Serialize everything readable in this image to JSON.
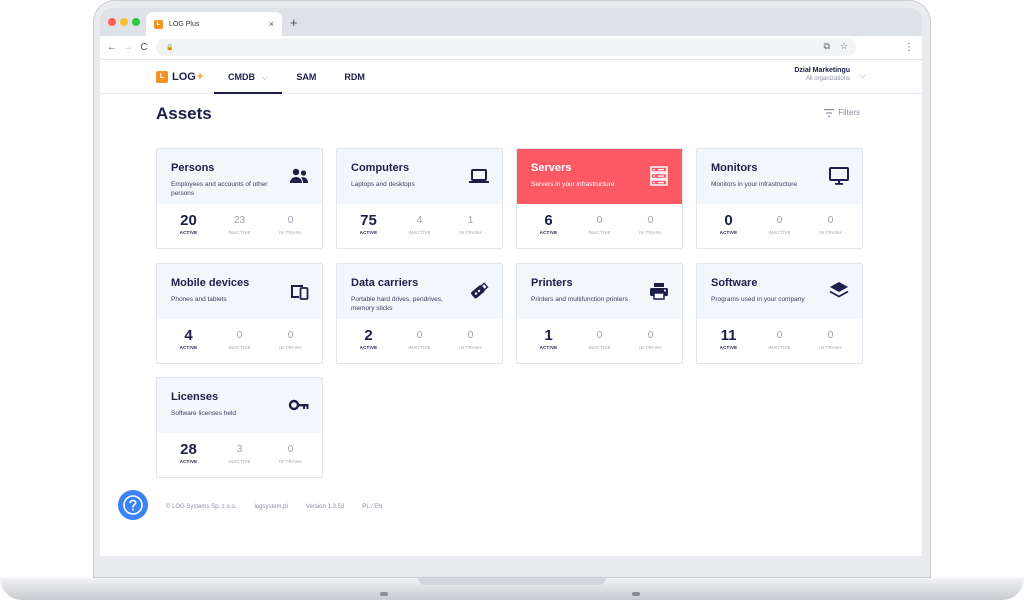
{
  "browser": {
    "tab_title": "LOG Plus",
    "tab_favicon_text": "L",
    "tab_close": "×",
    "new_tab": "+",
    "nav": {
      "back": "←",
      "forward": "→",
      "reload": "C"
    },
    "lock": "🔒",
    "translate_icon": "⧉",
    "star_icon": "☆",
    "menu": "⋮"
  },
  "header": {
    "logo_text": "LOG",
    "logo_plus": "+",
    "logo_box": "L",
    "nav": [
      {
        "label": "CMDB",
        "active": true,
        "chevron": "⌵"
      },
      {
        "label": "SAM"
      },
      {
        "label": "RDM"
      }
    ],
    "org_name": "Dział Marketingu",
    "org_sub": "All organizations",
    "org_chevron": "⌵"
  },
  "page": {
    "title": "Assets",
    "filters_label": "Filters"
  },
  "stat_labels": {
    "active": "ACTIVE",
    "inactive": "INACTIVE",
    "trash": "IN TRASH"
  },
  "cards": [
    {
      "title": "Persons",
      "desc": "Employees and accounts of other persons",
      "icon": "persons-icon",
      "active": "20",
      "inactive": "23",
      "trash": "0"
    },
    {
      "title": "Computers",
      "desc": "Laptops and desktops",
      "icon": "laptop-icon",
      "active": "75",
      "inactive": "4",
      "trash": "1"
    },
    {
      "title": "Servers",
      "desc": "Servers in your infrastructure",
      "icon": "server-icon",
      "active": "6",
      "inactive": "0",
      "trash": "0",
      "featured": true
    },
    {
      "title": "Monitors",
      "desc": "Monitors in your infrastructure",
      "icon": "monitor-icon",
      "active": "0",
      "inactive": "0",
      "trash": "0"
    },
    {
      "title": "Mobile devices",
      "desc": "Phones and tablets",
      "icon": "mobile-devices-icon",
      "active": "4",
      "inactive": "0",
      "trash": "0"
    },
    {
      "title": "Data carriers",
      "desc": "Portable hard drives, pendrives, memory sticks",
      "icon": "usb-drive-icon",
      "active": "2",
      "inactive": "0",
      "trash": "0"
    },
    {
      "title": "Printers",
      "desc": "Printers and multifunction printers",
      "icon": "printer-icon",
      "active": "1",
      "inactive": "0",
      "trash": "0"
    },
    {
      "title": "Software",
      "desc": "Programs used in your company",
      "icon": "layers-icon",
      "active": "11",
      "inactive": "0",
      "trash": "0"
    },
    {
      "title": "Licenses",
      "desc": "Software licenses held",
      "icon": "key-icon",
      "active": "28",
      "inactive": "3",
      "trash": "0"
    }
  ],
  "footer": {
    "copyright": "© LOG Systems Sp. z o.o.",
    "site": "logsystem.pl",
    "version": "Version 1.3.53",
    "language": "PL / EN"
  },
  "colors": {
    "navy": "#1c1f4a",
    "accent": "#fb5a65",
    "logo": "#f39322",
    "help": "#3b82f6"
  }
}
